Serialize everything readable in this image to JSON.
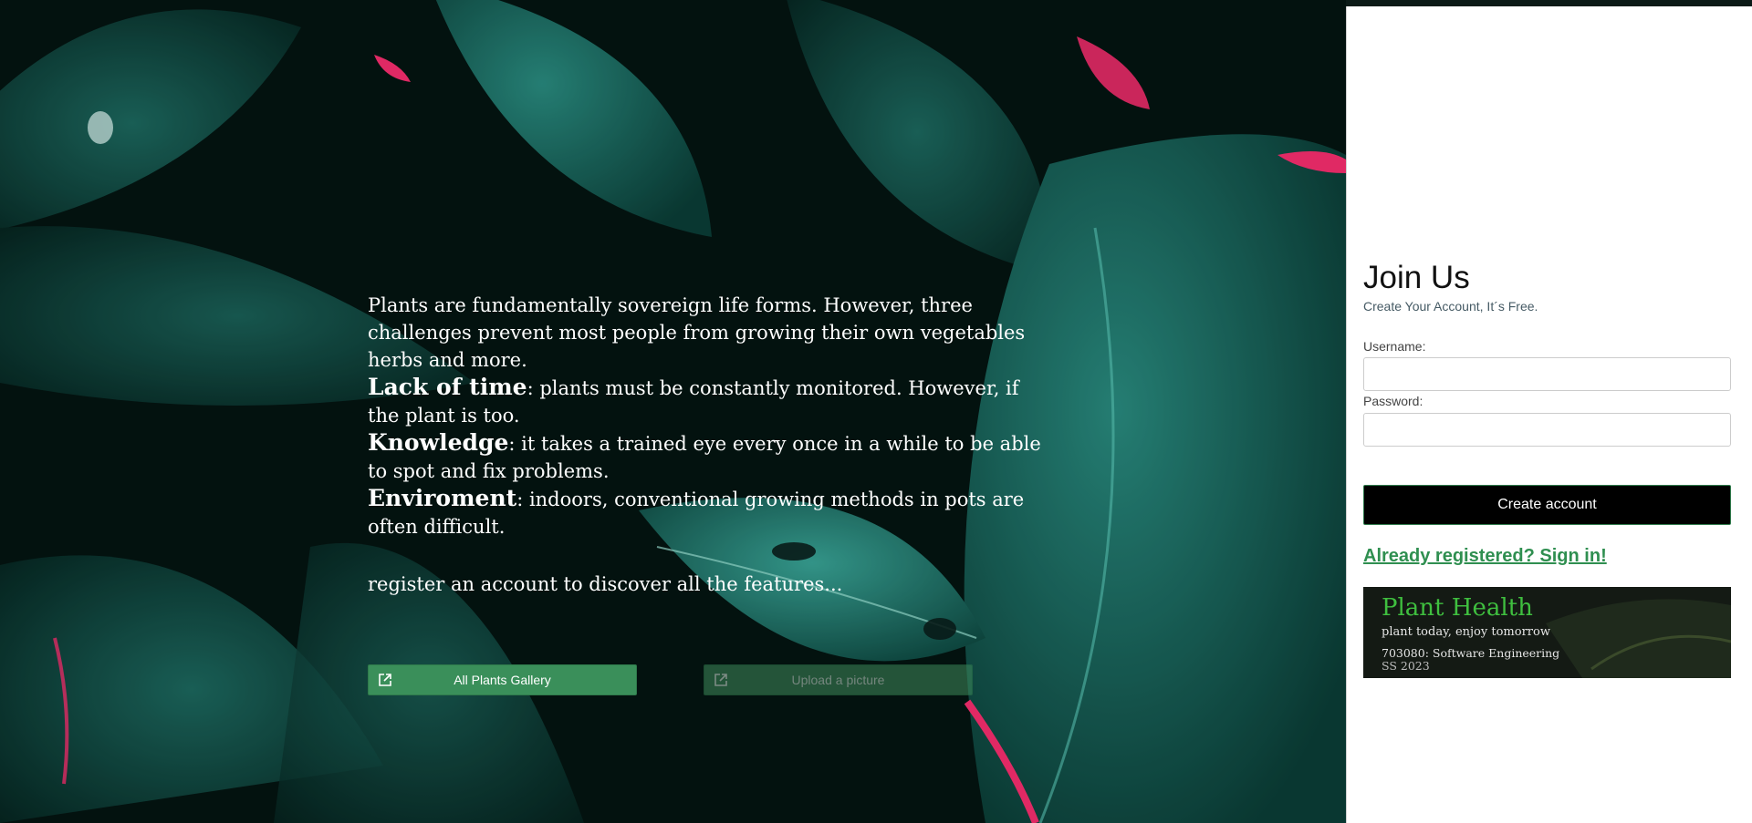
{
  "intro": {
    "paragraph": "Plants are fundamentally sovereign life forms. However, three challenges prevent most people from growing their own vegetables herbs and more.",
    "challenges": [
      {
        "term": "Lack of time",
        "text": ": plants must be constantly monitored. However, if the plant is too."
      },
      {
        "term": "Knowledge",
        "text": ": it takes a trained eye every once in a while to be able to spot and fix problems."
      },
      {
        "term": "Enviroment",
        "text": ": indoors, conventional growing methods in pots are often difficult."
      }
    ],
    "cta": "register an account to discover all the features..."
  },
  "buttons": {
    "gallery_label": "All Plants Gallery",
    "upload_label": "Upload a picture"
  },
  "panel": {
    "title": "Join Us",
    "subtitle": "Create Your Account, It´s Free.",
    "username_label": "Username:",
    "username_value": "",
    "password_label": "Password:",
    "password_value": "",
    "create_label": "Create account",
    "signin_label": "Already registered? Sign in!"
  },
  "banner": {
    "title": "Plant Health",
    "tagline": "plant today, enjoy tomorrow",
    "course": "703080: Software Engineering",
    "semester": "SS 2023"
  },
  "colors": {
    "accent_green": "#3a8f5a",
    "link_green": "#2f8f50",
    "leaf_teal": "#1f8f80",
    "leaf_pink": "#ff2f72"
  },
  "icons": [
    "external-link-icon"
  ]
}
